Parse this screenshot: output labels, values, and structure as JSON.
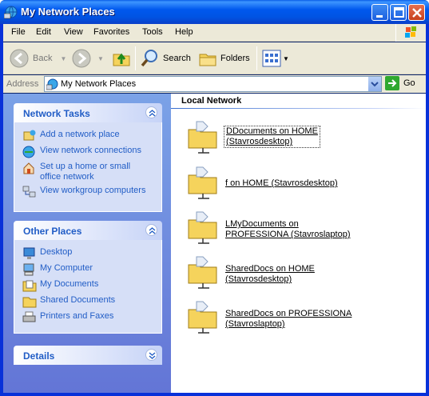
{
  "window": {
    "title": "My Network Places"
  },
  "menu": [
    "File",
    "Edit",
    "View",
    "Favorites",
    "Tools",
    "Help"
  ],
  "toolbar": {
    "back_label": "Back",
    "search_label": "Search",
    "folders_label": "Folders"
  },
  "address": {
    "label": "Address",
    "value": "My Network Places",
    "go_label": "Go"
  },
  "network_tasks": {
    "title": "Network Tasks",
    "items": [
      {
        "label": "Add a network place",
        "icon": "add-network-place-icon"
      },
      {
        "label": "View network connections",
        "icon": "network-connections-icon"
      },
      {
        "label": "Set up a home or small office network",
        "icon": "home-network-icon"
      },
      {
        "label": "View workgroup computers",
        "icon": "workgroup-computers-icon"
      }
    ]
  },
  "other_places": {
    "title": "Other Places",
    "items": [
      {
        "label": "Desktop",
        "icon": "desktop-icon"
      },
      {
        "label": "My Computer",
        "icon": "my-computer-icon"
      },
      {
        "label": "My Documents",
        "icon": "my-documents-icon"
      },
      {
        "label": "Shared Documents",
        "icon": "shared-documents-icon"
      },
      {
        "label": "Printers and Faxes",
        "icon": "printers-icon"
      }
    ]
  },
  "details": {
    "title": "Details"
  },
  "content": {
    "group_title": "Local Network",
    "shares": [
      {
        "line1": "DDocuments on HOME",
        "line2": "(Stavrosdesktop)"
      },
      {
        "line1": "f on HOME (Stavrosdesktop)",
        "line2": ""
      },
      {
        "line1": "LMyDocuments on",
        "line2": "PROFESSIONA (Stavroslaptop)"
      },
      {
        "line1": "SharedDocs on HOME",
        "line2": "(Stavrosdesktop)"
      },
      {
        "line1": "SharedDocs on PROFESSIONA",
        "line2": "(Stavroslaptop)"
      }
    ]
  },
  "colors": {
    "titlebar": "#0054e3",
    "task_link": "#215dc6",
    "left_pane": "#6f8fe0",
    "chrome": "#ece9d8"
  }
}
